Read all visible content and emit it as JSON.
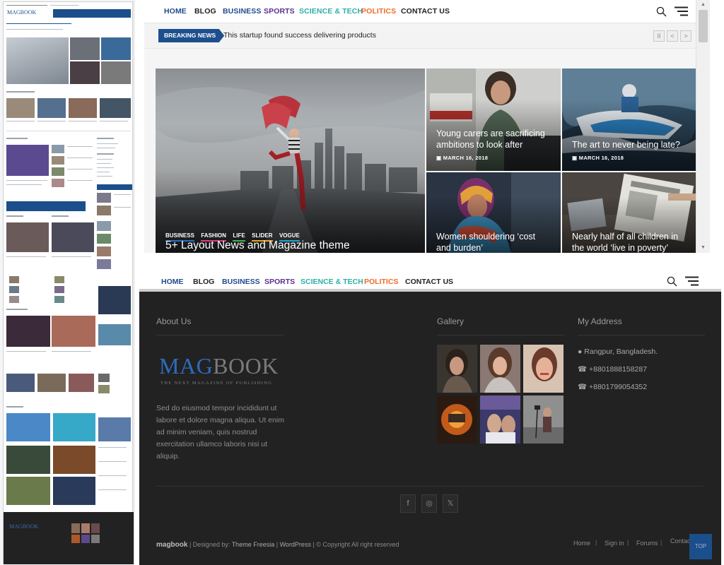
{
  "nav": {
    "items": [
      {
        "label": "HOME",
        "color": "#1f4b8e"
      },
      {
        "label": "BLOG",
        "color": "#222222"
      },
      {
        "label": "BUSINESS",
        "color": "#1f4b8e"
      },
      {
        "label": "SPORTS",
        "color": "#5a2d8f"
      },
      {
        "label": "SCIENCE & TECH",
        "color": "#2ab0a5"
      },
      {
        "label": "POLITICS",
        "color": "#f06a26"
      },
      {
        "label": "CONTACT US",
        "color": "#222222"
      }
    ]
  },
  "breaking": {
    "tag": "BREAKING NEWS",
    "text": "This startup found success delivering products",
    "pause": "II",
    "prev": "<",
    "next": ">"
  },
  "hero": {
    "categories": [
      {
        "label": "BUSINESS",
        "color": "#2b6cc4"
      },
      {
        "label": "FASHION",
        "color": "#e23b7c"
      },
      {
        "label": "LIFE",
        "color": "#38b64a"
      },
      {
        "label": "SLIDER",
        "color": "#f0a21e"
      },
      {
        "label": "VOGUE",
        "color": "#19a6d3"
      }
    ],
    "title": "5+ Layout News and Magazine theme"
  },
  "tiles": [
    {
      "caption": "Young carers are sacrificing ambitions to look after",
      "date": "MARCH 16, 2018"
    },
    {
      "caption": "The art to never being late?",
      "date": "MARCH 16, 2018"
    },
    {
      "caption": "Women shouldering ‘cost and burden’",
      "date": ""
    },
    {
      "caption": "Nearly half of all children in the world ‘live in poverty’",
      "date": ""
    }
  ],
  "footer": {
    "about": {
      "heading": "About Us",
      "logo_mag": "MAG",
      "logo_book": "BOOK",
      "tagline": "THE NEXT MAGAZINE OF PUBLISHING",
      "text": "Sed do eiusmod tempor incididunt ut labore et dolore magna aliqua. Ut enim ad minim veniam, quis nostrud exercitation ullamco laboris nisi ut aliquip."
    },
    "gallery": {
      "heading": "Gallery"
    },
    "address": {
      "heading": "My Address",
      "location": "Rangpur, Bangladesh.",
      "phone1": "+8801888158287",
      "phone2": "+8801799054352"
    },
    "social": [
      "f",
      "◎",
      "𝕏"
    ],
    "credits": {
      "brand": "magbook",
      "designed_by": "| Designed by:",
      "theme": "Theme Freesia",
      "sep": "|",
      "wp": "WordPress",
      "copyright": "| © Copyright All right reserved"
    },
    "links": [
      "Home",
      "Sign in",
      "Forums",
      "Contact Us"
    ],
    "top_button": "TOP"
  },
  "colors": {
    "accent": "#1f4b8e",
    "dark_footer": "#222222"
  }
}
